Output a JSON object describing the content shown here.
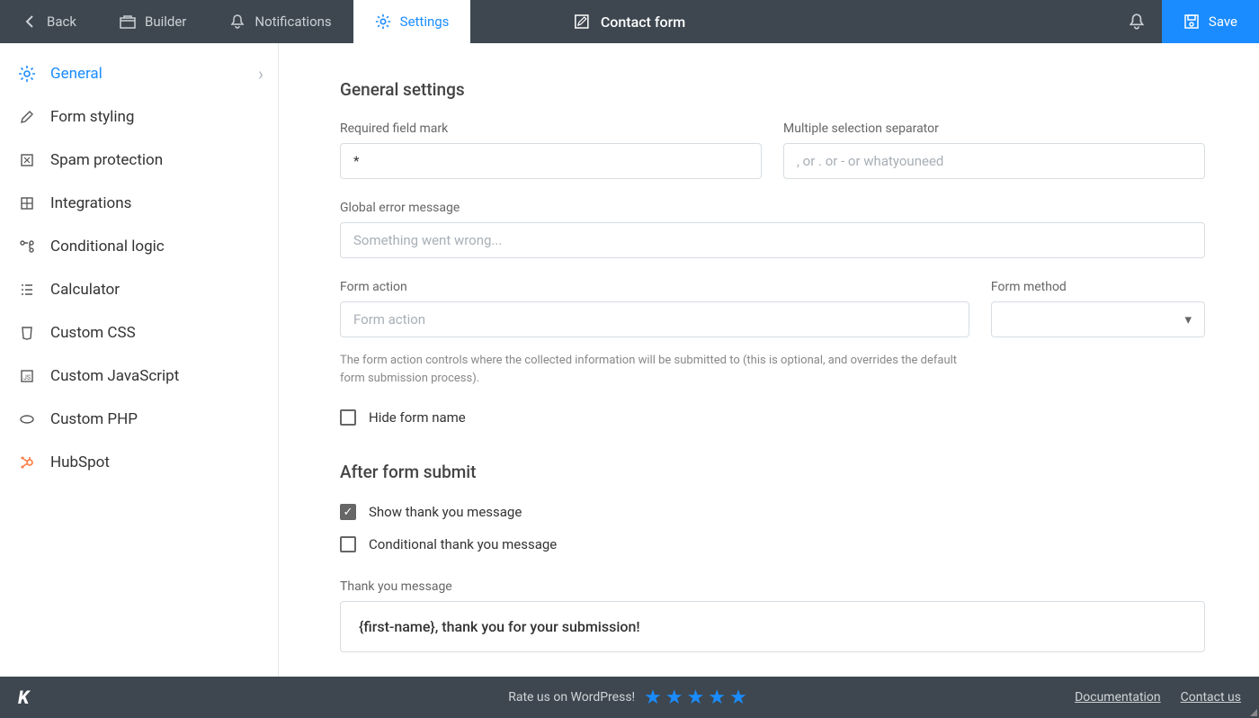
{
  "topbar": {
    "back": "Back",
    "builder": "Builder",
    "notifications": "Notifications",
    "settings": "Settings",
    "title": "Contact form",
    "save": "Save"
  },
  "sidebar": {
    "items": [
      {
        "label": "General",
        "icon": "gear",
        "active": true
      },
      {
        "label": "Form styling",
        "icon": "brush"
      },
      {
        "label": "Spam protection",
        "icon": "shield"
      },
      {
        "label": "Integrations",
        "icon": "plug"
      },
      {
        "label": "Conditional logic",
        "icon": "branch"
      },
      {
        "label": "Calculator",
        "icon": "list"
      },
      {
        "label": "Custom CSS",
        "icon": "css"
      },
      {
        "label": "Custom JavaScript",
        "icon": "js"
      },
      {
        "label": "Custom PHP",
        "icon": "php"
      },
      {
        "label": "HubSpot",
        "icon": "hubspot"
      }
    ]
  },
  "general": {
    "title": "General settings",
    "required_label": "Required field mark",
    "required_value": "*",
    "separator_label": "Multiple selection separator",
    "separator_placeholder": ", or . or - or whatyouneed",
    "global_error_label": "Global error message",
    "global_error_placeholder": "Something went wrong...",
    "form_action_label": "Form action",
    "form_action_placeholder": "Form action",
    "form_action_help": "The form action controls where the collected information will be submitted to (this is optional, and overrides the default form submission process).",
    "form_method_label": "Form method",
    "hide_form_name_label": "Hide form name"
  },
  "after": {
    "title": "After form submit",
    "show_thank_you_label": "Show thank you message",
    "conditional_label": "Conditional thank you message",
    "thank_you_label": "Thank you message",
    "thank_you_value": "{first-name}, thank you for your submission!"
  },
  "footer": {
    "rate_text": "Rate us on WordPress!",
    "doc": "Documentation",
    "contact": "Contact us"
  }
}
